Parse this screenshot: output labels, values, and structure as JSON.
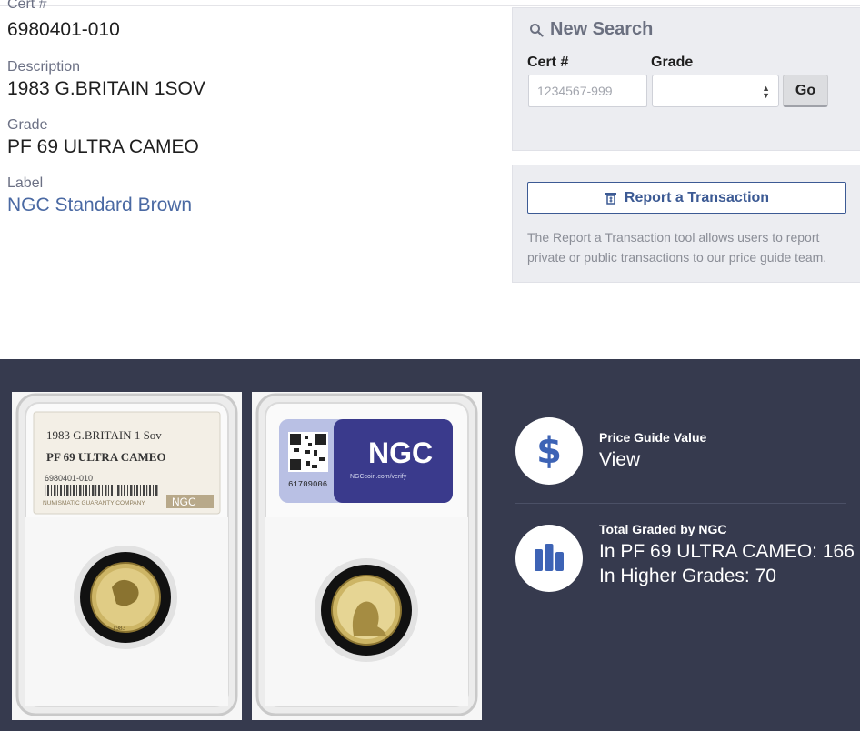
{
  "details": {
    "cert_label": "Cert #",
    "cert_value": "6980401-010",
    "description_label": "Description",
    "description_value": "1983 G.BRITAIN 1SOV",
    "grade_label": "Grade",
    "grade_value": "PF 69 ULTRA CAMEO",
    "label_label": "Label",
    "label_value": "NGC Standard Brown"
  },
  "search": {
    "title": "New Search",
    "cert_label": "Cert #",
    "cert_placeholder": "1234567-999",
    "grade_label": "Grade",
    "grade_selected": "",
    "go_label": "Go"
  },
  "report": {
    "button_label": "Report a Transaction",
    "description": "The Report a Transaction tool allows users to report private or public transactions to our price guide team."
  },
  "slab_front": {
    "line1": "1983 G.BRITAIN 1 Sov",
    "line2": "PF 69 ULTRA CAMEO",
    "cert": "6980401-010",
    "company": "NUMISMATIC GUARANTY COMPANY",
    "logo": "NGC",
    "coin_year": "1983"
  },
  "slab_back": {
    "logo": "NGC",
    "verify": "NGCcoin.com/verify",
    "code": "61709006"
  },
  "price_guide": {
    "title": "Price Guide Value",
    "link": "View",
    "icon": "dollar-icon"
  },
  "graded": {
    "title": "Total Graded by NGC",
    "in_grade": "In PF 69 ULTRA CAMEO: 166",
    "higher": "In Higher Grades: 70",
    "icon": "bar-chart-icon"
  },
  "colors": {
    "link": "#4a69a3",
    "dark_band": "#363a4e",
    "accent": "#3d63b5"
  }
}
